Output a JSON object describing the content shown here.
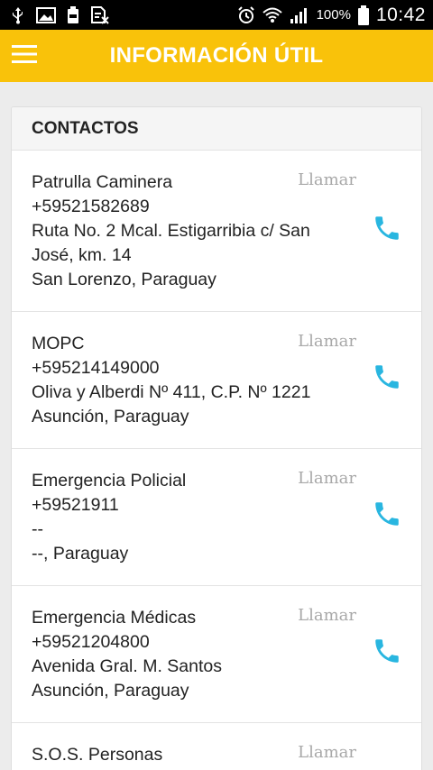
{
  "status_bar": {
    "battery_text": "100%",
    "time": "10:42",
    "icons": [
      "usb-icon",
      "image-icon",
      "battery-saver-icon",
      "sim-off-icon",
      "alarm-icon",
      "wifi-icon",
      "signal-icon",
      "battery-icon"
    ]
  },
  "app_bar": {
    "title": "INFORMACIÓN ÚTIL",
    "menu_icon": "menu-icon",
    "color": "#f9c20a"
  },
  "section": {
    "header": "CONTACTOS"
  },
  "contacts": [
    {
      "name": "Patrulla Caminera",
      "phone": "+59521582689",
      "address": "Ruta No. 2 Mcal. Estigarribia c/ San José, km. 14",
      "city": "San Lorenzo, Paraguay",
      "action_label": "Llamar"
    },
    {
      "name": "MOPC",
      "phone": "+595214149000",
      "address": "Oliva y Alberdi Nº 411, C.P. Nº 1221",
      "city": "Asunción, Paraguay",
      "action_label": "Llamar"
    },
    {
      "name": "Emergencia Policial",
      "phone": "+59521911",
      "address": "--",
      "city": "--, Paraguay",
      "action_label": "Llamar"
    },
    {
      "name": "Emergencia Médicas",
      "phone": "+59521204800",
      "address": "Avenida Gral. M. Santos",
      "city": "Asunción, Paraguay",
      "action_label": "Llamar"
    },
    {
      "name": "S.O.S. Personas",
      "action_label": "Llamar"
    }
  ],
  "colors": {
    "accent": "#f9c20a",
    "call_icon": "#29b6e0"
  }
}
